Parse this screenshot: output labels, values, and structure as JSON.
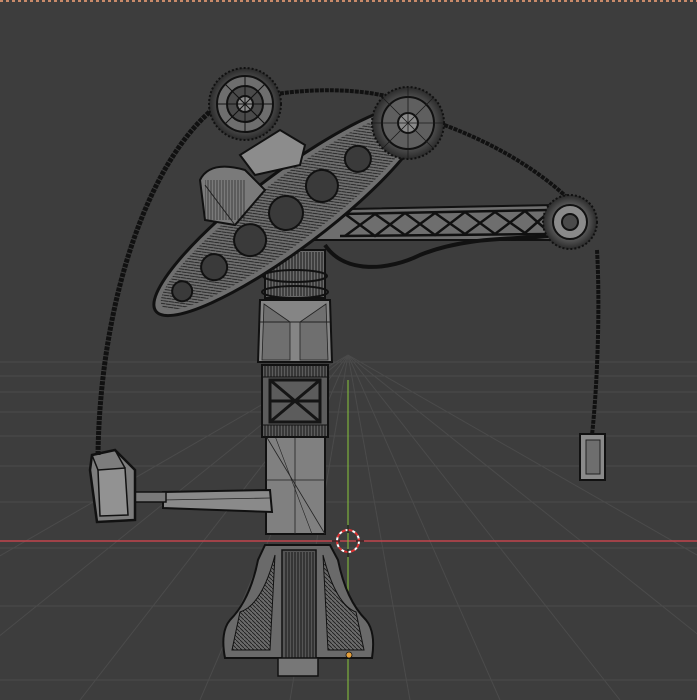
{
  "viewport": {
    "background": "#3d3d3d",
    "grid_color": "#4a4a4a",
    "x_axis_color": "#c2444d",
    "y_axis_color": "#7db13d",
    "top_border_color": "#c98a6a"
  },
  "scene": {
    "shading": "wireframe-solid",
    "mesh_color": "#8c8c8c",
    "wire_color": "#111111",
    "cursor_icon": "3d-cursor-icon",
    "origin_icon": "origin-dot-icon",
    "origin_color": "#e6a03b"
  }
}
